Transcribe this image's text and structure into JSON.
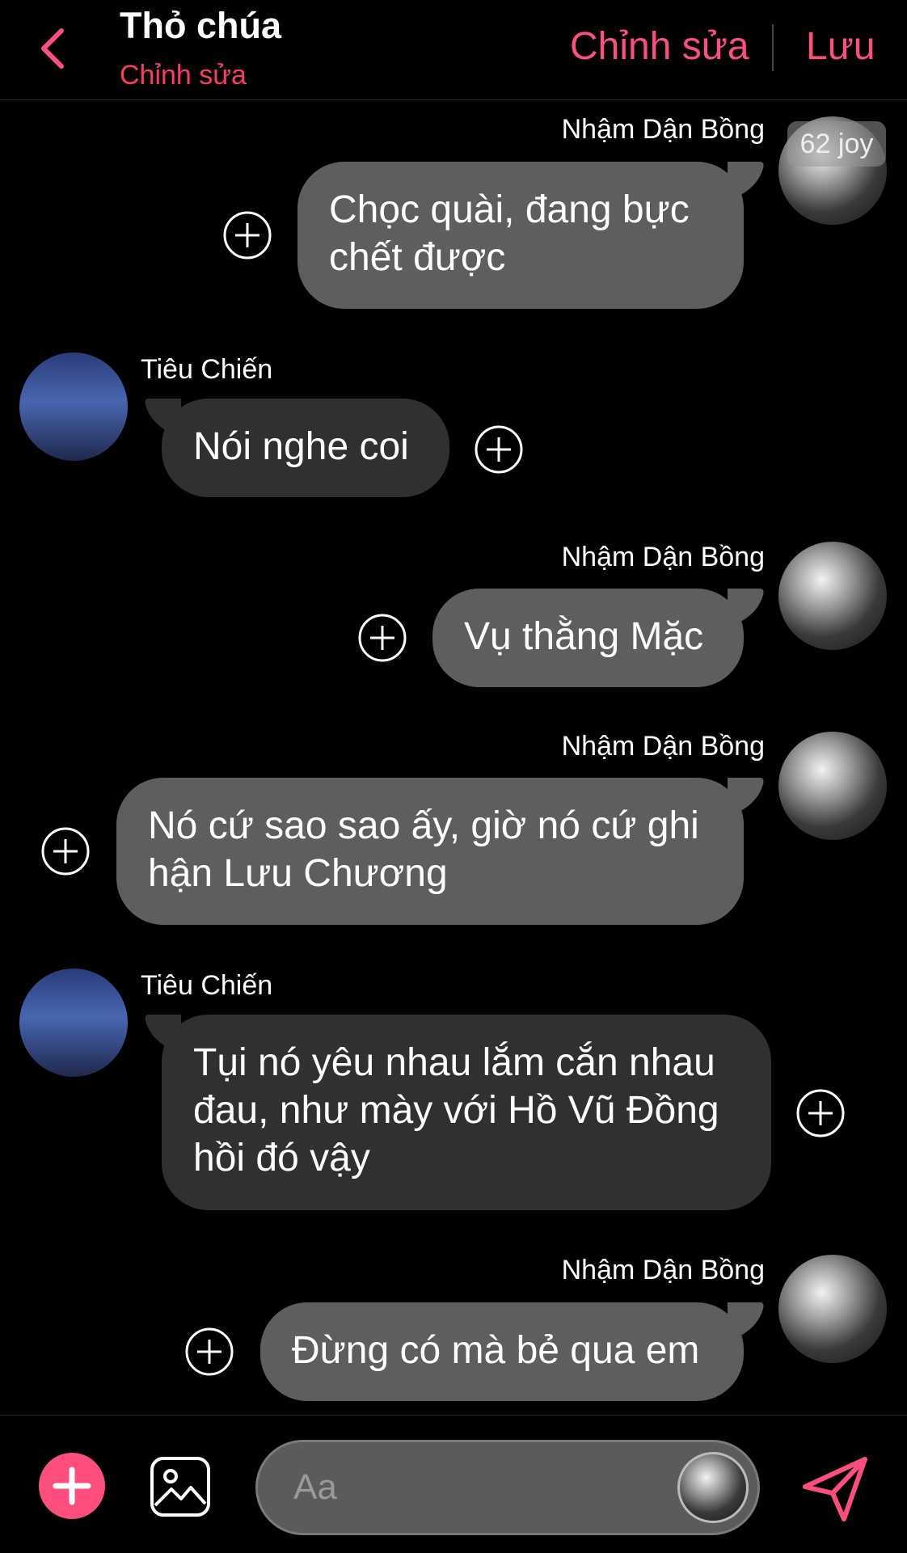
{
  "header": {
    "title": "Thỏ chúa",
    "subtitle": "Chỉnh sửa",
    "edit_label": "Chỉnh sửa",
    "save_label": "Lưu"
  },
  "badge": "62 joy",
  "messages": [
    {
      "sender": "Nhậm Dận Bồng",
      "side": "right",
      "text": "Chọc quài, đang bực chết được"
    },
    {
      "sender": "Tiêu Chiến",
      "side": "left",
      "text": "Nói nghe coi"
    },
    {
      "sender": "Nhậm Dận Bồng",
      "side": "right",
      "text": "Vụ thằng Mặc"
    },
    {
      "sender": "Nhậm Dận Bồng",
      "side": "right",
      "text": "Nó cứ sao sao ấy, giờ nó cứ ghi hận Lưu Chương"
    },
    {
      "sender": "Tiêu Chiến",
      "side": "left",
      "text": "Tụi nó yêu nhau lắm cắn nhau đau, như mày với Hồ Vũ Đồng hồi đó vậy"
    },
    {
      "sender": "Nhậm Dận Bồng",
      "side": "right",
      "text": "Đừng có mà bẻ qua em"
    }
  ],
  "composer": {
    "placeholder": "Aa"
  },
  "colors": {
    "accent": "#ff4d7d",
    "subtitle": "#ff3a5e",
    "bubble_me": "#5e5e5e",
    "bubble_them": "#303030",
    "background": "#000000"
  }
}
